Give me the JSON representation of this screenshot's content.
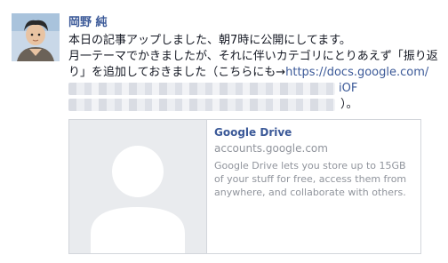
{
  "post": {
    "author": "岡野 純",
    "line1": "本日の記事アップしました、朝7時に公開にしてます。",
    "line2": "月一テーマでかきましたが、それに伴いカテゴリにとりあえず「振り返り」を追加しておきました（こちらにも→",
    "link_visible": "https://docs.google.com/",
    "link_visible_tail": "iOF",
    "closing": "）。"
  },
  "attachment": {
    "title": "Google Drive",
    "domain": "accounts.google.com",
    "description": "Google Drive lets you store up to 15GB of your stuff for free, access them from anywhere, and collaborate with others."
  },
  "icons": {
    "avatar": "profile-photo",
    "placeholder": "default-person-silhouette"
  },
  "colors": {
    "link": "#3b5998",
    "text": "#141823",
    "muted": "#90949c",
    "border": "#d3d6db",
    "placeholder_bg": "#e9ebee"
  }
}
